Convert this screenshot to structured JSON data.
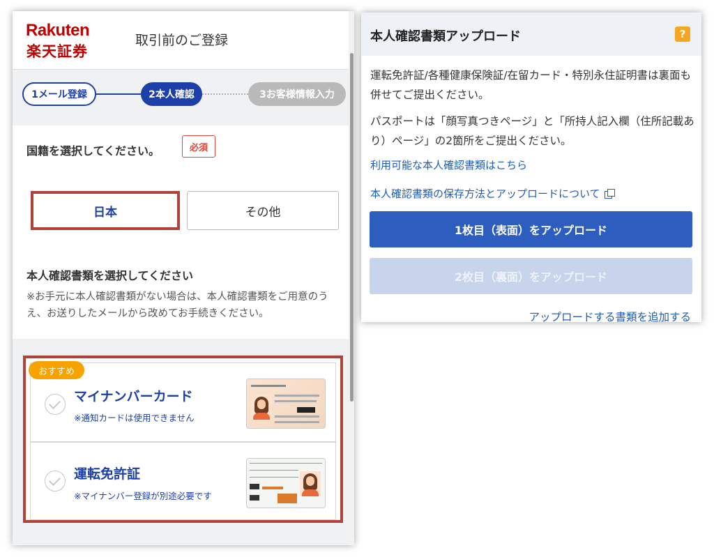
{
  "left": {
    "logo_en": "Rakuten",
    "logo_jp": "楽天証券",
    "header_title": "取引前のご登録",
    "steps": [
      {
        "label": "1メール登録"
      },
      {
        "label": "2本人確認"
      },
      {
        "label": "3お客様情報入力"
      }
    ],
    "nationality": {
      "label": "国籍を選択してください。",
      "required": "必須",
      "options": [
        "日本",
        "その他"
      ],
      "selected": "日本"
    },
    "documents": {
      "title": "本人確認書類を選択してください",
      "note": "※お手元に本人確認書類がない場合は、本人確認書類をご用意のうえ、お送りしたメールから改めてお手続きください。",
      "recommended_badge": "おすすめ",
      "items": [
        {
          "title": "マイナンバーカード",
          "sub": "※通知カードは使用できません"
        },
        {
          "title": "運転免許証",
          "sub": "※マイナンバー登録が別途必要です"
        }
      ]
    }
  },
  "right": {
    "title": "本人確認書類アップロード",
    "help": "?",
    "para1": "運転免許証/各種健康保険証/在留カード・特別永住証明書は裏面も併せてご提出ください。",
    "para2": "パスポートは「顔写真つきページ」と「所持人記入欄（住所記載あり）ページ」の2箇所をご提出ください。",
    "link1": "利用可能な本人確認書類はこちら",
    "link2": "本人確認書類の保存方法とアップロードについて",
    "upload1": "1枚目（表面）をアップロード",
    "upload2": "2枚目（裏面）をアップロード",
    "add_link": "アップロードする書類を追加する"
  },
  "colors": {
    "brand_red": "#bf0000",
    "primary_blue": "#1d3fa8",
    "button_blue": "#2d5dbf",
    "highlight_border": "#b0423a",
    "badge_orange": "#f6a300"
  }
}
